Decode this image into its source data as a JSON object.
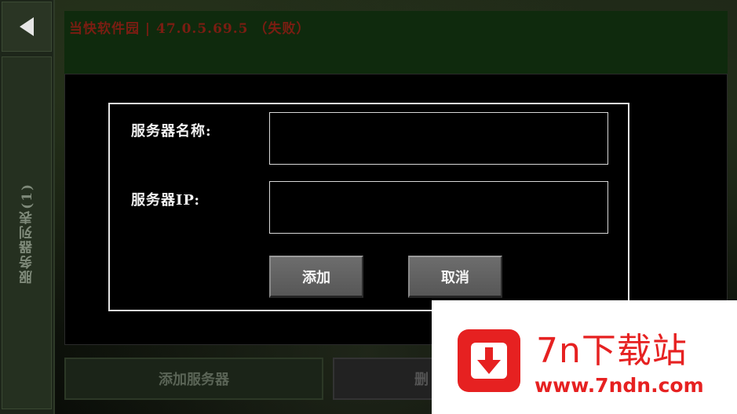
{
  "header": {
    "title": "当快软件园 | 47.0.5.69.5 （失败）"
  },
  "sidebar": {
    "back_icon": "back-arrow-icon",
    "tab_label": "服务器列表(1)"
  },
  "dialog": {
    "name_label": "服务器名称:",
    "ip_label": "服务器IP:",
    "name_value": "",
    "ip_value": "",
    "add_label": "添加",
    "cancel_label": "取消"
  },
  "bottom": {
    "add_server_label": "添加服务器",
    "delete_label": "删"
  },
  "watermark": {
    "name": "7n下载站",
    "url": "www.7ndn.com",
    "accent": "#e62121",
    "icon": "download-arrow-icon"
  }
}
